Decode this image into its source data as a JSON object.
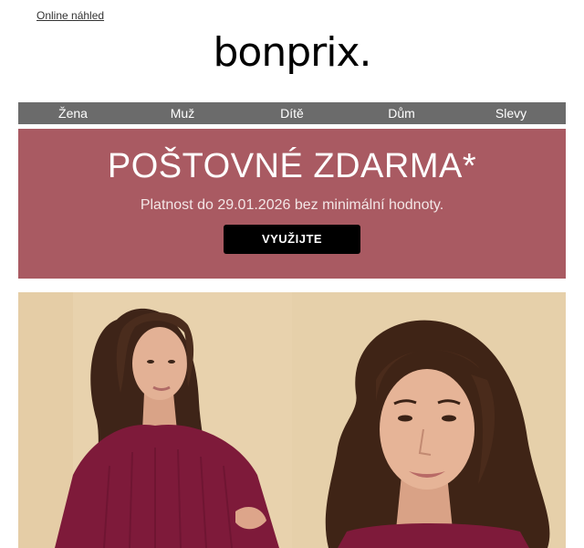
{
  "header": {
    "preview_link": "Online náhled",
    "logo": "bonprix."
  },
  "nav": {
    "items": [
      "Žena",
      "Muž",
      "Dítě",
      "Dům",
      "Slevy"
    ]
  },
  "promo": {
    "title": "POŠTOVNÉ ZDARMA*",
    "subtitle": "Platnost do 29.01.2026 bez minimální hodnoty.",
    "button": "VYUŽIJTE"
  },
  "colors": {
    "promo_bg": "#a95a62",
    "nav_bg": "#6b6b6b",
    "sweater": "#7e1a3a",
    "backdrop": "#e7d1ab"
  }
}
